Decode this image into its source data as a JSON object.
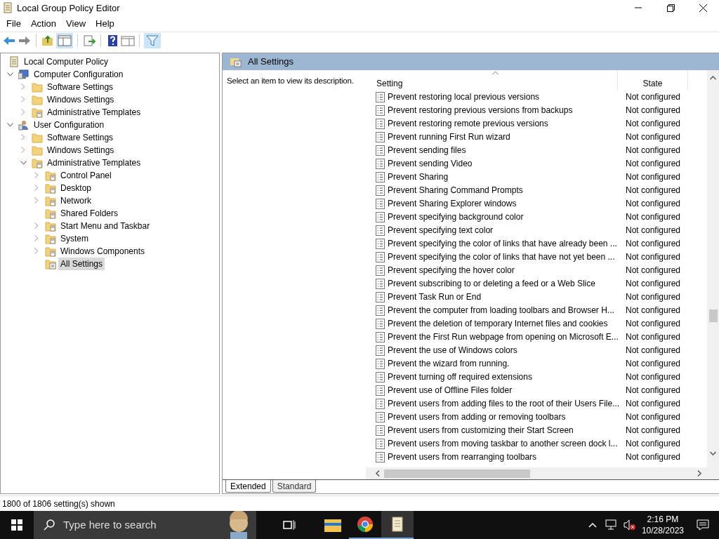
{
  "window": {
    "title": "Local Group Policy Editor"
  },
  "menu": [
    "File",
    "Action",
    "View",
    "Help"
  ],
  "tree": [
    {
      "label": "Local Computer Policy",
      "kind": "policy",
      "selected": false,
      "children": [
        {
          "label": "Computer Configuration",
          "kind": "computer",
          "expanded": true,
          "selected": false,
          "children": [
            {
              "label": "Software Settings",
              "kind": "folder",
              "expanded": false,
              "selected": false
            },
            {
              "label": "Windows Settings",
              "kind": "folder",
              "expanded": false,
              "selected": false
            },
            {
              "label": "Administrative Templates",
              "kind": "admin",
              "expanded": false,
              "selected": false
            }
          ]
        },
        {
          "label": "User Configuration",
          "kind": "user",
          "expanded": true,
          "selected": false,
          "children": [
            {
              "label": "Software Settings",
              "kind": "folder",
              "expanded": false,
              "selected": false
            },
            {
              "label": "Windows Settings",
              "kind": "folder",
              "expanded": false,
              "selected": false
            },
            {
              "label": "Administrative Templates",
              "kind": "admin",
              "expanded": true,
              "selected": false,
              "children": [
                {
                  "label": "Control Panel",
                  "kind": "admin",
                  "expanded": false,
                  "selected": false
                },
                {
                  "label": "Desktop",
                  "kind": "admin",
                  "expanded": false,
                  "selected": false
                },
                {
                  "label": "Network",
                  "kind": "admin",
                  "expanded": false,
                  "selected": false
                },
                {
                  "label": "Shared Folders",
                  "kind": "admin",
                  "selected": false
                },
                {
                  "label": "Start Menu and Taskbar",
                  "kind": "admin",
                  "expanded": false,
                  "selected": false
                },
                {
                  "label": "System",
                  "kind": "admin",
                  "expanded": false,
                  "selected": false
                },
                {
                  "label": "Windows Components",
                  "kind": "admin",
                  "expanded": false,
                  "selected": false
                },
                {
                  "label": "All Settings",
                  "kind": "all",
                  "selected": true
                }
              ]
            }
          ]
        }
      ]
    }
  ],
  "panel": {
    "title": "All Settings",
    "description": "Select an item to view its description."
  },
  "table": {
    "columns": [
      "Setting",
      "State"
    ],
    "rows": [
      [
        "Prevent restoring local previous versions",
        "Not configured"
      ],
      [
        "Prevent restoring previous versions from backups",
        "Not configured"
      ],
      [
        "Prevent restoring remote previous versions",
        "Not configured"
      ],
      [
        "Prevent running First Run wizard",
        "Not configured"
      ],
      [
        "Prevent sending files",
        "Not configured"
      ],
      [
        "Prevent sending Video",
        "Not configured"
      ],
      [
        "Prevent Sharing",
        "Not configured"
      ],
      [
        "Prevent Sharing Command Prompts",
        "Not configured"
      ],
      [
        "Prevent Sharing Explorer windows",
        "Not configured"
      ],
      [
        "Prevent specifying background color",
        "Not configured"
      ],
      [
        "Prevent specifying text color",
        "Not configured"
      ],
      [
        "Prevent specifying the color of links that have already been ...",
        "Not configured"
      ],
      [
        "Prevent specifying the color of links that have not yet been ...",
        "Not configured"
      ],
      [
        "Prevent specifying the hover color",
        "Not configured"
      ],
      [
        "Prevent subscribing to or deleting a feed or a Web Slice",
        "Not configured"
      ],
      [
        "Prevent Task Run or End",
        "Not configured"
      ],
      [
        "Prevent the computer from loading toolbars and Browser H...",
        "Not configured"
      ],
      [
        "Prevent the deletion of temporary Internet files and cookies",
        "Not configured"
      ],
      [
        "Prevent the First Run webpage from opening on Microsoft E...",
        "Not configured"
      ],
      [
        "Prevent the use of Windows colors",
        "Not configured"
      ],
      [
        "Prevent the wizard from running.",
        "Not configured"
      ],
      [
        "Prevent turning off required extensions",
        "Not configured"
      ],
      [
        "Prevent use of Offline Files folder",
        "Not configured"
      ],
      [
        "Prevent users from adding files to the root of their Users File...",
        "Not configured"
      ],
      [
        "Prevent users from adding or removing toolbars",
        "Not configured"
      ],
      [
        "Prevent users from customizing their Start Screen",
        "Not configured"
      ],
      [
        "Prevent users from moving taskbar to another screen dock l...",
        "Not configured"
      ],
      [
        "Prevent users from rearranging toolbars",
        "Not configured"
      ]
    ]
  },
  "tabs": [
    {
      "label": "Extended",
      "selected": true
    },
    {
      "label": "Standard",
      "selected": false
    }
  ],
  "status_bar": "1800 of 1806 setting(s) shown",
  "taskbar": {
    "search_placeholder": "Type here to search",
    "time": "2:16 PM",
    "date": "10/28/2023"
  }
}
